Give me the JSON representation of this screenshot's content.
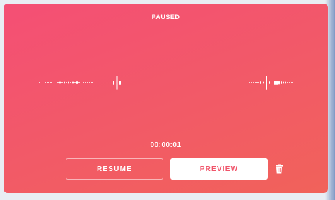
{
  "recorder": {
    "status": "PAUSED",
    "elapsed": "00:00:01",
    "buttons": {
      "resume_label": "RESUME",
      "preview_label": "PREVIEW"
    },
    "icons": {
      "delete": "trash-icon"
    },
    "colors": {
      "gradient_start": "#f44f75",
      "gradient_end": "#f1625a",
      "preview_text": "#f0546a",
      "white": "#ffffff"
    }
  }
}
